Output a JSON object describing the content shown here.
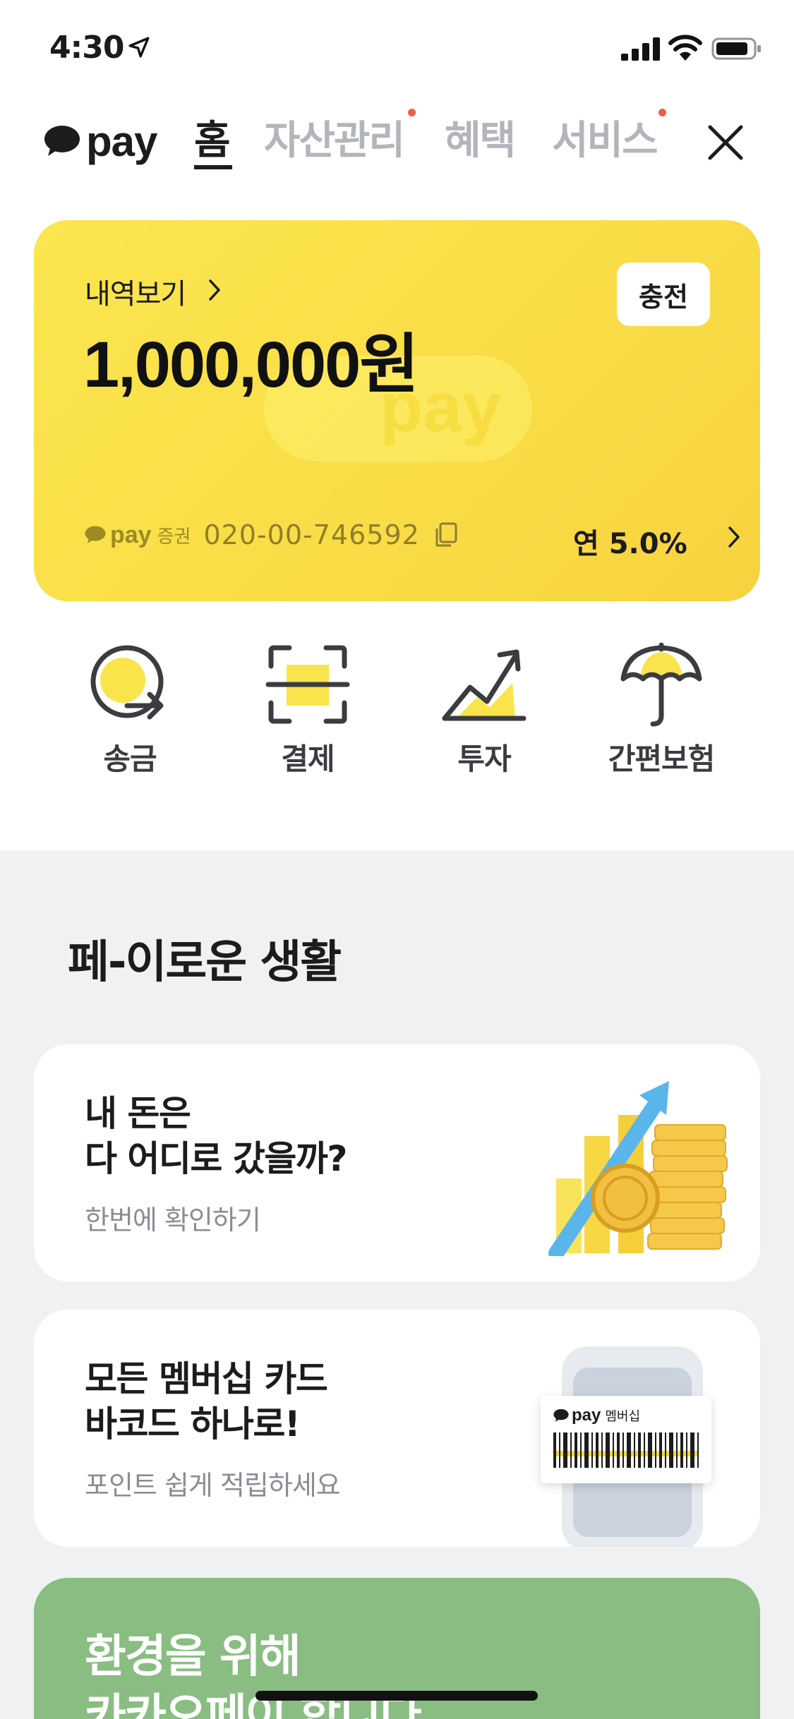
{
  "status_bar": {
    "time": "4:30"
  },
  "nav": {
    "logo_text": "pay",
    "tabs": [
      {
        "label": "홈",
        "active": true,
        "badge": false
      },
      {
        "label": "자산관리",
        "active": false,
        "badge": true
      },
      {
        "label": "혜택",
        "active": false,
        "badge": false
      },
      {
        "label": "서비스",
        "active": false,
        "badge": true
      }
    ]
  },
  "balance_card": {
    "history_label": "내역보기",
    "balance": "1,000,000원",
    "charge_label": "충전",
    "watermark": "pay",
    "account_brand": "pay",
    "account_brand_sub": "증권",
    "account_number": "020-00-746592",
    "rate": "연 5.0%"
  },
  "quick_actions": [
    {
      "label": "송금",
      "icon": "send-money-icon"
    },
    {
      "label": "결제",
      "icon": "scan-pay-icon"
    },
    {
      "label": "투자",
      "icon": "invest-chart-icon"
    },
    {
      "label": "간편보험",
      "icon": "umbrella-icon"
    }
  ],
  "section_title": "페-이로운 생활",
  "promos": [
    {
      "title": "내 돈은\n다 어디로 갔을까?",
      "subtitle": "한번에 확인하기",
      "image": "coins-growth-illustration"
    },
    {
      "title": "모든 멤버십 카드\n바코드 하나로!",
      "subtitle": "포인트 쉽게 적립하세요",
      "image": "membership-barcode-illustration",
      "image_brand": "pay",
      "image_caption": "멤버십"
    }
  ],
  "green_banner": {
    "title": "환경을 위해\n카카오페이 합니다"
  },
  "colors": {
    "accent_yellow": "#fae44c",
    "badge_red": "#f15b48",
    "green": "#89bd82"
  }
}
